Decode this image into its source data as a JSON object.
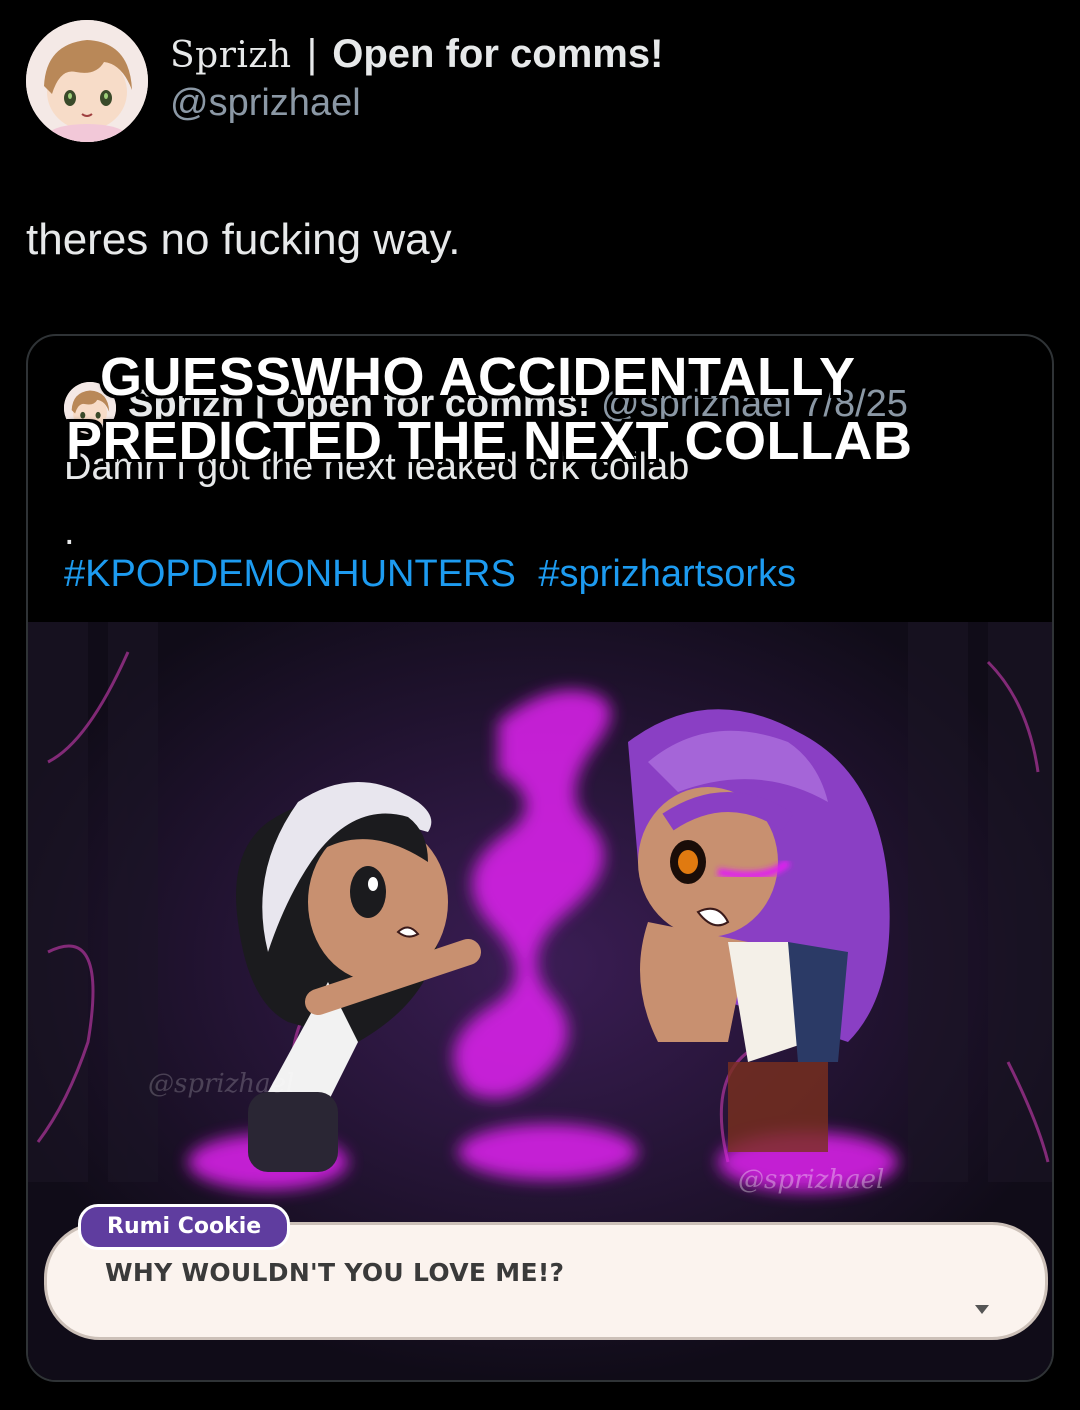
{
  "author": {
    "name_styled": "Sprizh",
    "name_sep": "|",
    "name_bold": "Open for comms!",
    "handle": "@sprizhael"
  },
  "tweet": {
    "text": "theres no fucking way."
  },
  "overlay_caption": {
    "line1": "GUESSWHO ACCIDENTALLY",
    "line2": "PREDICTED THE NEXT COLLAB"
  },
  "quoted": {
    "name": "Sprizh | Open for comms!",
    "handle": "@sprizhael",
    "date": "7/8/25",
    "text": "Damn I got the next leaked crk collab",
    "dot": ".",
    "hashtags": [
      "#KPOPDEMONHUNTERS",
      "#sprizhartsorks"
    ]
  },
  "artwork": {
    "watermark_left": "@sprizhael",
    "watermark_right": "@sprizhael",
    "dialogue_speaker": "Rumi Cookie",
    "dialogue_text": "WHY WOULDN'T YOU LOVE ME!?",
    "accent_magenta": "#e020f0",
    "accent_purple": "#5f3d9f"
  }
}
